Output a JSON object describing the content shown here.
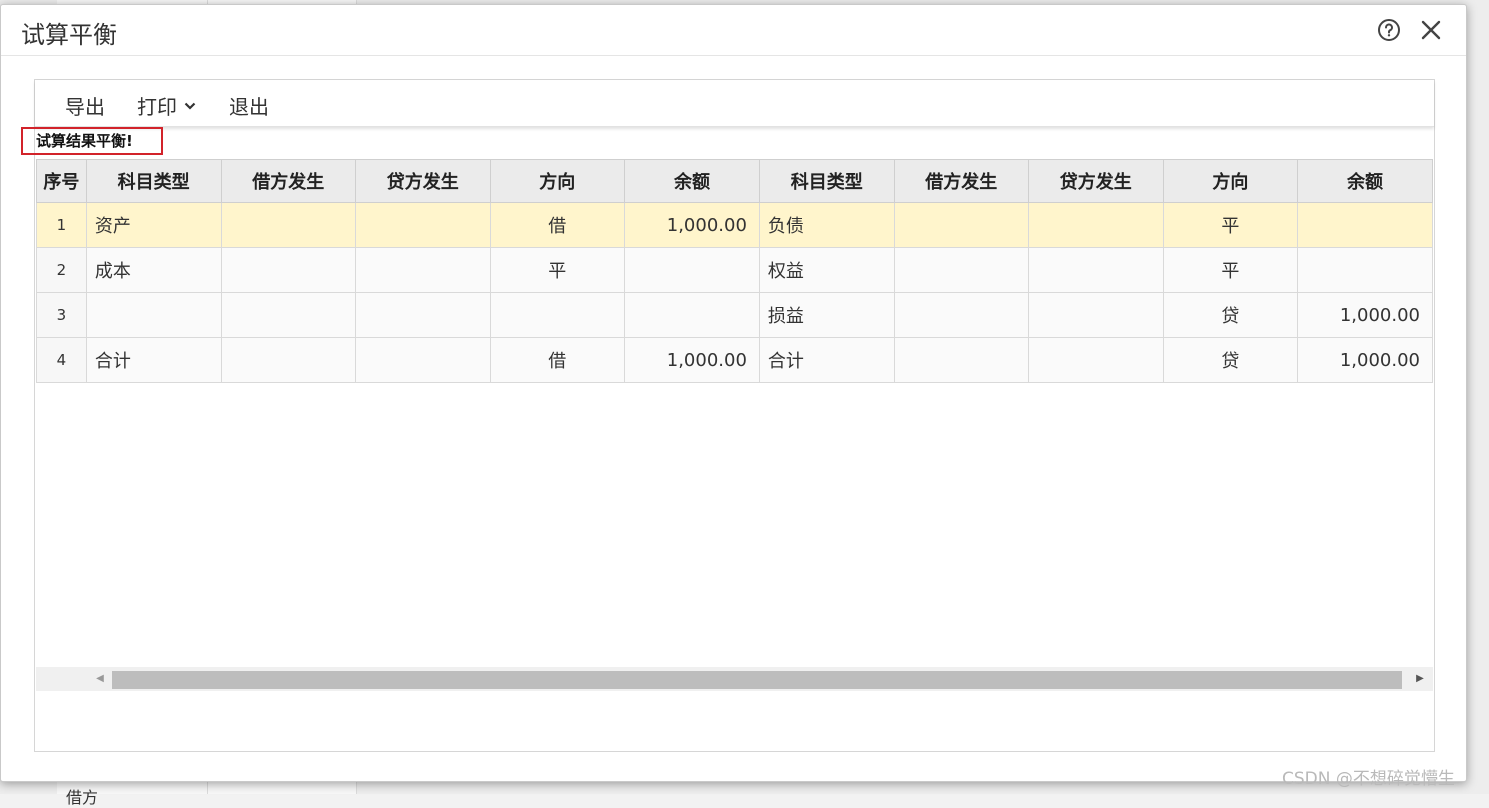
{
  "dialog": {
    "title": "试算平衡"
  },
  "toolbar": {
    "export_label": "导出",
    "print_label": "打印",
    "exit_label": "退出"
  },
  "result_message": "试算结果平衡!",
  "table": {
    "headers": [
      "序号",
      "科目类型",
      "借方发生",
      "贷方发生",
      "方向",
      "余额",
      "科目类型",
      "借方发生",
      "贷方发生",
      "方向",
      "余额"
    ],
    "rows": [
      [
        "1",
        "资产",
        "",
        "",
        "借",
        "1,000.00",
        "负债",
        "",
        "",
        "平",
        ""
      ],
      [
        "2",
        "成本",
        "",
        "",
        "平",
        "",
        "权益",
        "",
        "",
        "平",
        ""
      ],
      [
        "3",
        "",
        "",
        "",
        "",
        "",
        "损益",
        "",
        "",
        "贷",
        "1,000.00"
      ],
      [
        "4",
        "合计",
        "",
        "",
        "借",
        "1,000.00",
        "合计",
        "",
        "",
        "贷",
        "1,000.00"
      ]
    ],
    "selected_row": 0
  },
  "background": {
    "partial_text": "借方"
  },
  "watermark": "CSDN @不想碎觉懵生"
}
